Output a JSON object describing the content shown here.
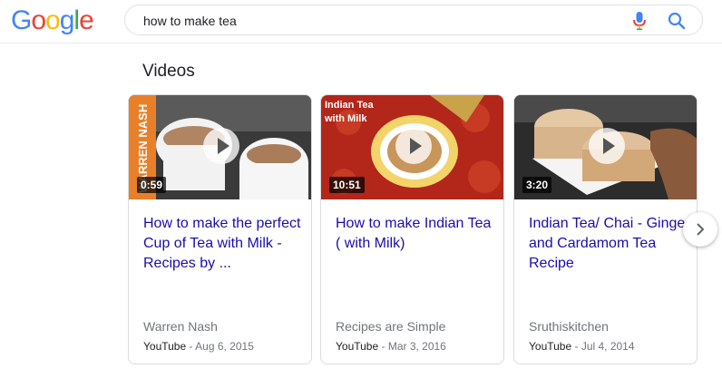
{
  "header": {
    "logo_letters": [
      "G",
      "o",
      "o",
      "g",
      "l",
      "e"
    ],
    "logo_colors": [
      "#4285f4",
      "#ea4335",
      "#fbbc05",
      "#4285f4",
      "#34a853",
      "#ea4335"
    ],
    "search_query": "how to make tea"
  },
  "section": {
    "title": "Videos"
  },
  "videos": [
    {
      "title": "How to make the perfect Cup of Tea with Milk - Recipes by ...",
      "duration": "0:59",
      "channel": "Warren Nash",
      "source": "YouTube",
      "date": " - Aug 6, 2015",
      "thumb_text": "WARREN NASH"
    },
    {
      "title": "How to make Indian Tea ( with Milk)",
      "duration": "10:51",
      "channel": "Recipes are Simple",
      "source": "YouTube",
      "date": " - Mar 3, 2016",
      "thumb_text": "Indian Tea with Milk"
    },
    {
      "title": "Indian Tea/ Chai - Ginger and Cardamom Tea Recipe",
      "duration": "3:20",
      "channel": "Sruthiskitchen",
      "source": "YouTube",
      "date": " - Jul 4, 2014"
    }
  ],
  "colors": {
    "link": "#1a0dab",
    "meta": "#70757a",
    "border": "#dadce0"
  }
}
